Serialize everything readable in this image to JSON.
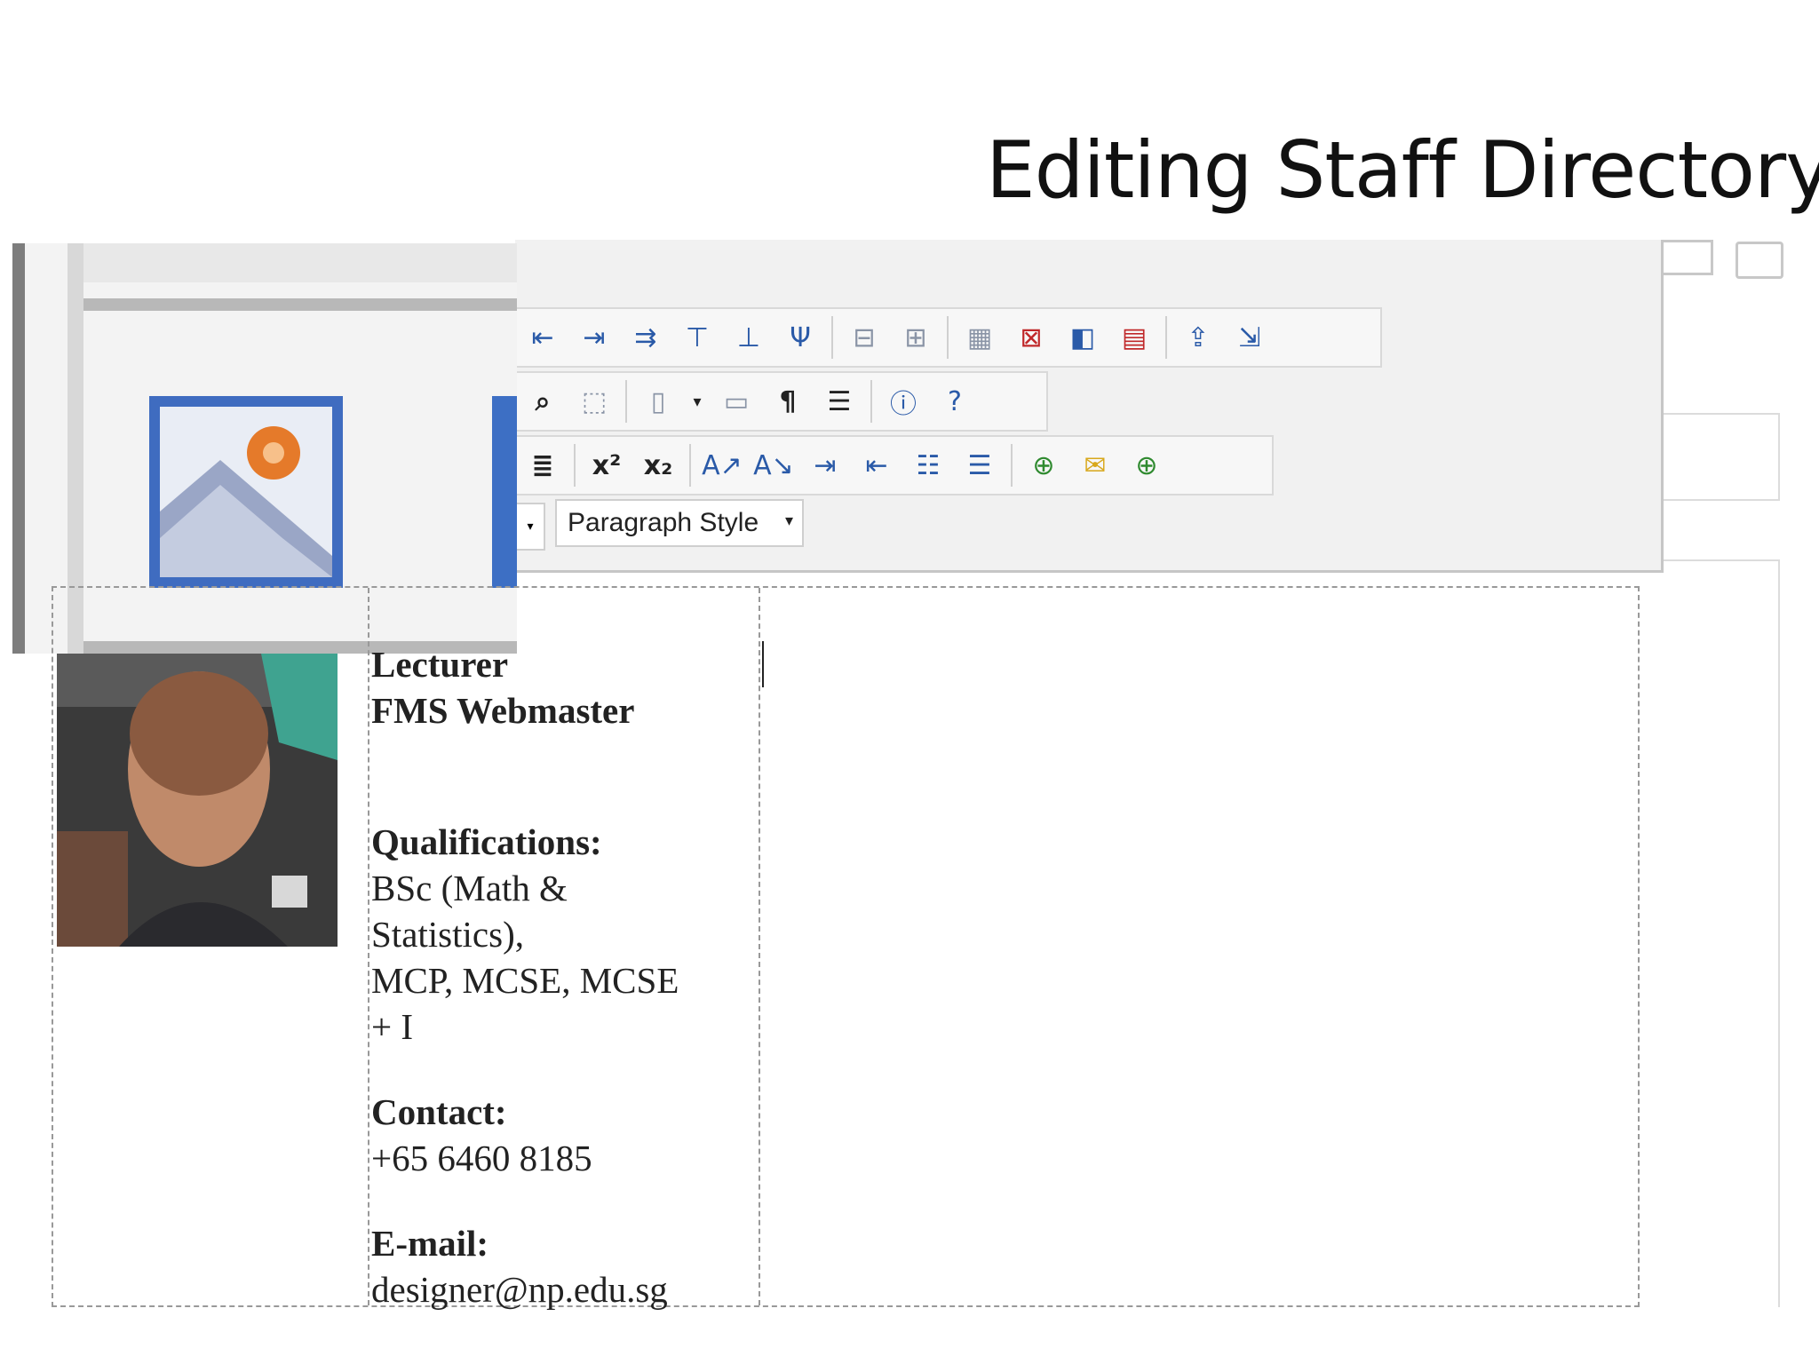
{
  "slide": {
    "title": "Editing Staff Directory"
  },
  "toolbar": {
    "row1_icons": [
      "insert-column-left-icon",
      "insert-column-right-icon",
      "insert-column-icon",
      "insert-row-above-icon",
      "insert-row-below-icon",
      "split-cell-icon",
      "merge-cells-icon",
      "merge-right-icon",
      "table-icon",
      "delete-table-icon",
      "cell-properties-icon",
      "table-properties-icon",
      "export-icon",
      "import-icon"
    ],
    "row2_icons": [
      "find-replace-icon",
      "select-all-icon",
      "source-icon",
      "dropdown-arrow-icon",
      "template-icon",
      "paragraph-marks-icon",
      "justify-icon",
      "info-icon",
      "help-icon"
    ],
    "row3_icons": [
      "align-icon",
      "superscript-icon",
      "subscript-icon",
      "text-size-up-icon",
      "text-size-down-icon",
      "indent-icon",
      "outdent-icon",
      "numbered-list-icon",
      "bulleted-list-icon",
      "hyperlink-icon",
      "email-link-icon",
      "anchor-link-icon"
    ],
    "paragraph_style": "Paragraph Style"
  },
  "zoom_inset": {
    "icon": "insert-image-icon"
  },
  "profile": {
    "role_line1": "Lecturer",
    "role_line2": "FMS Webmaster",
    "qualifications_label": "Qualifications:",
    "qualifications_line1": "BSc (Math &",
    "qualifications_line2": "Statistics),",
    "qualifications_line3": "MCP, MCSE, MCSE",
    "qualifications_line4": "+ I",
    "contact_label": "Contact:",
    "contact_value": "+65 6460 8185",
    "email_label": "E-mail:",
    "email_value": "designer@np.edu.sg"
  }
}
